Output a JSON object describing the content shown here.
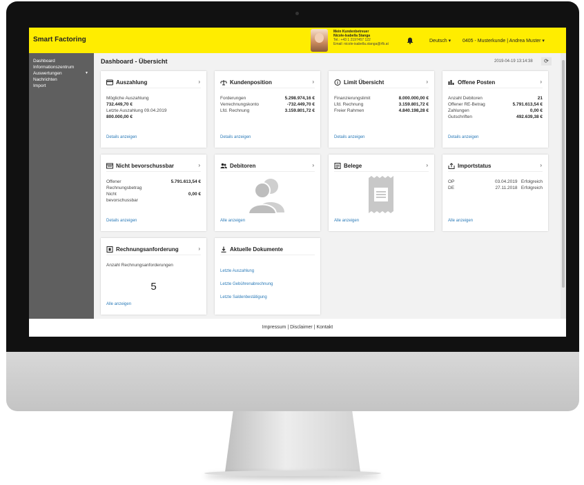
{
  "app": {
    "brand": "Smart Factoring"
  },
  "advisor": {
    "heading": "Mein Kundenbetreuer",
    "name": "Nicole-Isabella Stanga",
    "phone": "Tel.:   +43 1 2197457 122",
    "email": "Email:  nicole-isabella.stanga@rfb.at"
  },
  "header": {
    "language": "Deutsch ▾",
    "customer": "0405 - Musterkunde | Andrea Muster ▾"
  },
  "sidebar": {
    "items": [
      {
        "label": "Dashboard"
      },
      {
        "label": "Informationszentrum"
      },
      {
        "label": "Auswertungen",
        "caret": "▼"
      },
      {
        "label": "Nachrichten"
      },
      {
        "label": "Import"
      }
    ]
  },
  "page": {
    "title": "Dashboard - Übersicht",
    "timestamp": "2019-04-19 13:14:38"
  },
  "cards": {
    "auszahlung": {
      "title": "Auszahlung",
      "line1": "Mögliche Auszahlung",
      "value1": "732.449,70 €",
      "line2": "Letzte Auszahlung 09.04.2019",
      "value2": "800.000,00 €",
      "link": "Details anzeigen"
    },
    "kundenposition": {
      "title": "Kundenposition",
      "rows": [
        {
          "label": "Forderungen",
          "value": "5.298.974,16 €"
        },
        {
          "label": "Verrechnungskonto",
          "value": "-732.449,70 €"
        },
        {
          "label": "Lfd. Rechnung",
          "value": "3.159.801,72 €"
        }
      ],
      "link": "Details anzeigen"
    },
    "limit": {
      "title": "Limit Übersicht",
      "rows": [
        {
          "label": "Finanzierungslimit",
          "value": "8.000.000,00 €"
        },
        {
          "label": "Lfd. Rechnung",
          "value": "3.159.801,72 €"
        },
        {
          "label": "Freier Rahmen",
          "value": "4.840.198,28 €"
        }
      ],
      "link": "Details anzeigen"
    },
    "offene": {
      "title": "Offene Posten",
      "rows": [
        {
          "label": "Anzahl Debitoren",
          "value": "21"
        },
        {
          "label": "Offener RE-Betrag",
          "value": "5.791.613,54 €"
        },
        {
          "label": "Zahlungen",
          "value": "0,00 €"
        },
        {
          "label": "Gutschriften",
          "value": "492.639,38 €"
        }
      ],
      "link": "Details anzeigen"
    },
    "nicht": {
      "title": "Nicht bevorschussbar",
      "row1_label_a": "Offener",
      "row1_label_b": "Rechnungsbetrag",
      "row1_value": "5.791.613,54 €",
      "row2_label_a": "Nicht",
      "row2_label_b": "bevorschussbar",
      "row2_value": "0,00 €",
      "link": "Details anzeigen"
    },
    "debitoren": {
      "title": "Debitoren",
      "link": "Alle anzeigen"
    },
    "belege": {
      "title": "Belege",
      "link": "Alle anzeigen"
    },
    "import": {
      "title": "Importstatus",
      "rows": [
        {
          "type": "OP",
          "date": "03.04.2019",
          "status": "Erfolgreich"
        },
        {
          "type": "DE",
          "date": "27.11.2018",
          "status": "Erfolgreich"
        }
      ],
      "link": "Alle anzeigen"
    },
    "rechnung": {
      "title": "Rechnungsanforderung",
      "label": "Anzahl Rechnungsanforderungen",
      "count": "5",
      "link": "Alle anzeigen"
    },
    "dokumente": {
      "title": "Aktuelle Dokumente",
      "links": [
        "Letzte Auszahlung",
        "Letzte Gebührenabrechnung",
        "Letzte Saldenbestätigung"
      ]
    }
  },
  "footer": {
    "text": "Impressum | Disclaimer  | Kontakt"
  },
  "colors": {
    "brand": "#ffed00",
    "sidebar": "#5f5f5f",
    "link": "#2a7ab8"
  }
}
